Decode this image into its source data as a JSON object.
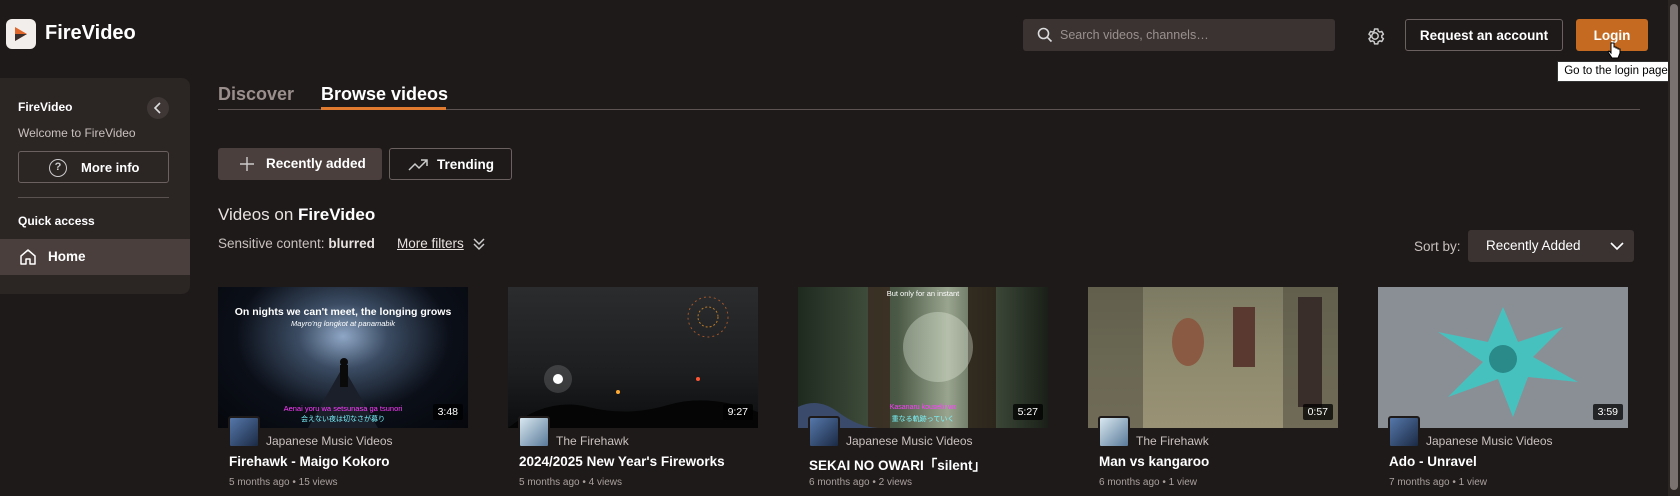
{
  "app": {
    "brand": "FireVideo"
  },
  "header": {
    "search_placeholder": "Search videos, channels…",
    "request_account_label": "Request an account",
    "login_label": "Login",
    "login_tooltip": "Go to the login page"
  },
  "sidebar": {
    "title": "FireVideo",
    "welcome": "Welcome to FireVideo",
    "more_info_label": "More info",
    "quick_access_label": "Quick access",
    "home_label": "Home"
  },
  "tabs": [
    {
      "label": "Discover",
      "active": false
    },
    {
      "label": "Browse videos",
      "active": true
    }
  ],
  "sort_buttons": {
    "recently_added": "Recently added",
    "trending": "Trending"
  },
  "listing": {
    "heading_prefix": "Videos on",
    "heading_brand": "FireVideo",
    "sensitive_label": "Sensitive content:",
    "sensitive_value": "blurred",
    "more_filters": "More filters",
    "sort_by_label": "Sort by:",
    "sort_value": "Recently Added"
  },
  "videos": [
    {
      "title": "Firehawk - Maigo Kokoro",
      "channel": "Japanese Music Videos",
      "meta": "5 months ago • 15 views",
      "duration": "3:48",
      "overlay_top": "On nights we can't meet, the longing grows",
      "overlay_sub": "Mayro'ng longkot at panamabik",
      "overlay_bottom1": "Aenai yoru wa setsunasa ga tsunori",
      "overlay_bottom2": "会えない夜は切なさが募り"
    },
    {
      "title": "2024/2025 New Year's Fireworks",
      "channel": "The Firehawk",
      "meta": "5 months ago • 4 views",
      "duration": "9:27"
    },
    {
      "title": "SEKAI NO OWARI「silent」",
      "channel": "Japanese Music Videos",
      "meta": "6 months ago • 2 views",
      "duration": "5:27",
      "overlay_top": "But only for an instant",
      "overlay_bottom1": "Kasanaru kouseki wo",
      "overlay_bottom2": "重なる軌跡っていく"
    },
    {
      "title": "Man vs kangaroo",
      "channel": "The Firehawk",
      "meta": "6 months ago • 1 view",
      "duration": "0:57"
    },
    {
      "title": "Ado - Unravel",
      "channel": "Japanese Music Videos",
      "meta": "7 months ago • 1 view",
      "duration": "3:59"
    }
  ],
  "colors": {
    "accent": "#c46a21",
    "background": "#1e1a19",
    "sidebar": "#2b2524",
    "active_item": "#4a3f3d",
    "tab_underline": "#e07a2e"
  },
  "icons": [
    "play-logo-icon",
    "search-icon",
    "gear-icon",
    "chevron-left-icon",
    "question-icon",
    "home-icon",
    "plus-icon",
    "trending-icon",
    "double-chevron-down-icon",
    "chevron-down-icon",
    "pointer-cursor-icon"
  ]
}
